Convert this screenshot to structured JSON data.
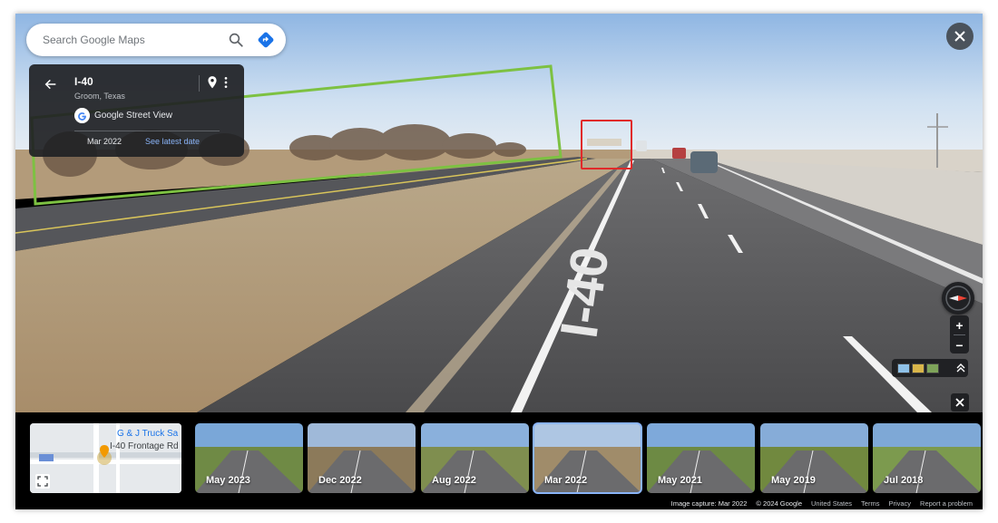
{
  "search": {
    "placeholder": "Search Google Maps"
  },
  "card": {
    "title": "I-40",
    "subtitle": "Groom, Texas",
    "source": "Google Street View",
    "date": "Mar 2022",
    "latest_link": "See latest date"
  },
  "road_marking": "I-40",
  "minimap": {
    "business": "G & J Truck Sa",
    "road": "I-40 Frontage Rd"
  },
  "timeline": [
    {
      "label": "May 2023",
      "selected": false
    },
    {
      "label": "Dec 2022",
      "selected": false
    },
    {
      "label": "Aug 2022",
      "selected": false
    },
    {
      "label": "Mar 2022",
      "selected": true
    },
    {
      "label": "May 2021",
      "selected": false
    },
    {
      "label": "May 2019",
      "selected": false
    },
    {
      "label": "Jul 2018",
      "selected": false
    }
  ],
  "footer": {
    "capture": "Image capture: Mar 2022",
    "copyright": "© 2024 Google",
    "region": "United States",
    "terms": "Terms",
    "privacy": "Privacy",
    "report": "Report a problem"
  },
  "zoom": {
    "in": "+",
    "out": "−"
  },
  "icons": [
    "search-icon",
    "directions-icon",
    "back-arrow-icon",
    "pin-icon",
    "more-vert-icon",
    "close-icon",
    "compass-icon",
    "expand-icon",
    "chevron-up-icon"
  ],
  "colors": {
    "accent": "#8ab4f8",
    "panel": "#202124",
    "annotation_green": "#7dc142",
    "annotation_red": "#e02a2a"
  }
}
